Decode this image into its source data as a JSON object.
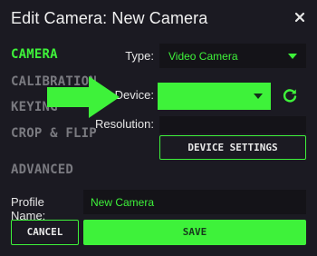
{
  "dialog": {
    "title": "Edit Camera: New Camera"
  },
  "nav": {
    "items": [
      {
        "label": "CAMERA",
        "active": true
      },
      {
        "label": "CALIBRATION",
        "active": false
      },
      {
        "label": "KEYING",
        "active": false
      },
      {
        "label": "CROP & FLIP",
        "active": false
      },
      {
        "label": "ADVANCED",
        "active": false
      }
    ]
  },
  "form": {
    "type_label": "Type:",
    "type_value": "Video Camera",
    "device_label": "Device:",
    "device_value": "",
    "resolution_label": "Resolution:",
    "resolution_value": "",
    "device_settings_label": "DEVICE SETTINGS",
    "profile_name_label": "Profile Name:",
    "profile_name_value": "New Camera"
  },
  "actions": {
    "cancel_label": "CANCEL",
    "save_label": "SAVE"
  },
  "icons": {
    "close": "close-icon",
    "refresh": "refresh-icon",
    "dropdown": "chevron-down-icon",
    "pointer": "arrow-right-icon"
  },
  "colors": {
    "accent": "#3ef23a",
    "background": "#1b1a22",
    "field": "#141318",
    "muted": "#7a7a80"
  }
}
